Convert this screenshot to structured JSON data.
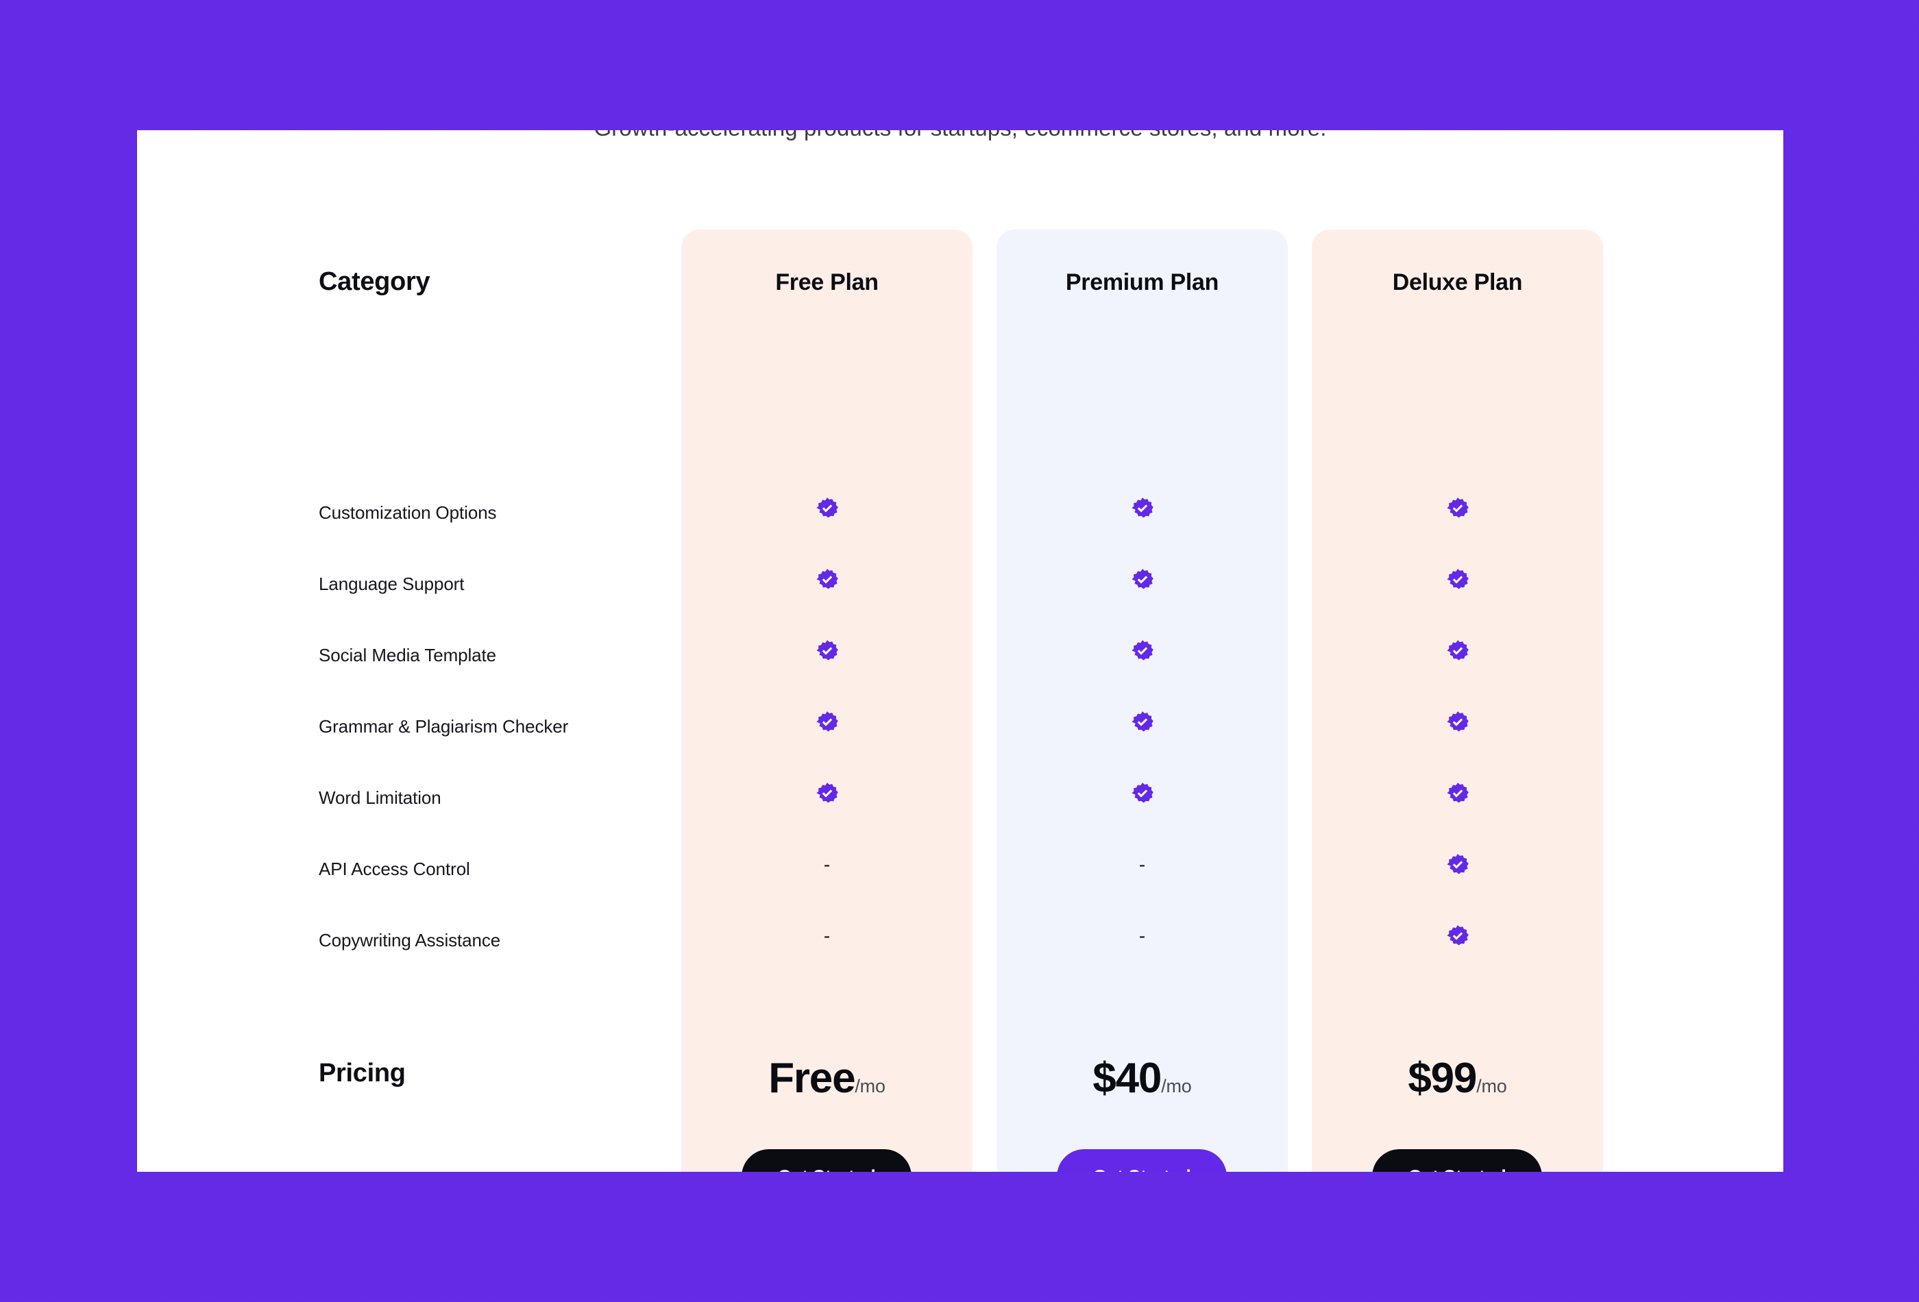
{
  "page": {
    "background_color": "#6428E8",
    "panel_background": "#FFFFFF",
    "subtitle": "Growth-accelerating products for startups, ecommerce stores, and more."
  },
  "table": {
    "category_header": "Category",
    "pricing_header": "Pricing",
    "included_icon": "verified-badge-check-icon",
    "excluded_marker": "-",
    "columns": [
      {
        "name": "Free Plan",
        "card_color": "#FDEFE8",
        "price_amount": "Free",
        "price_period": "/mo",
        "cta_label": "Get Started",
        "cta_color": "#0B0B12"
      },
      {
        "name": "Premium Plan",
        "card_color": "#F1F4FD",
        "price_amount": "$40",
        "price_period": "/mo",
        "cta_label": "Get Started",
        "cta_color": "#6428E8"
      },
      {
        "name": "Deluxe Plan",
        "card_color": "#FDEFE8",
        "price_amount": "$99",
        "price_period": "/mo",
        "cta_label": "Get Started",
        "cta_color": "#0B0B12"
      }
    ],
    "features": [
      {
        "label": "Customization Options",
        "values": [
          "included",
          "included",
          "included"
        ]
      },
      {
        "label": "Language Support",
        "values": [
          "included",
          "included",
          "included"
        ]
      },
      {
        "label": "Social Media Template",
        "values": [
          "included",
          "included",
          "included"
        ]
      },
      {
        "label": "Grammar & Plagiarism Checker",
        "values": [
          "included",
          "included",
          "included"
        ]
      },
      {
        "label": "Word Limitation",
        "values": [
          "included",
          "included",
          "included"
        ]
      },
      {
        "label": "API Access Control",
        "values": [
          "excluded",
          "excluded",
          "included"
        ]
      },
      {
        "label": "Copywriting Assistance",
        "values": [
          "excluded",
          "excluded",
          "included"
        ]
      }
    ]
  },
  "colors": {
    "brand_purple": "#6428E8",
    "text_dark": "#0D0D14",
    "badge_purple": "#6428E8"
  }
}
